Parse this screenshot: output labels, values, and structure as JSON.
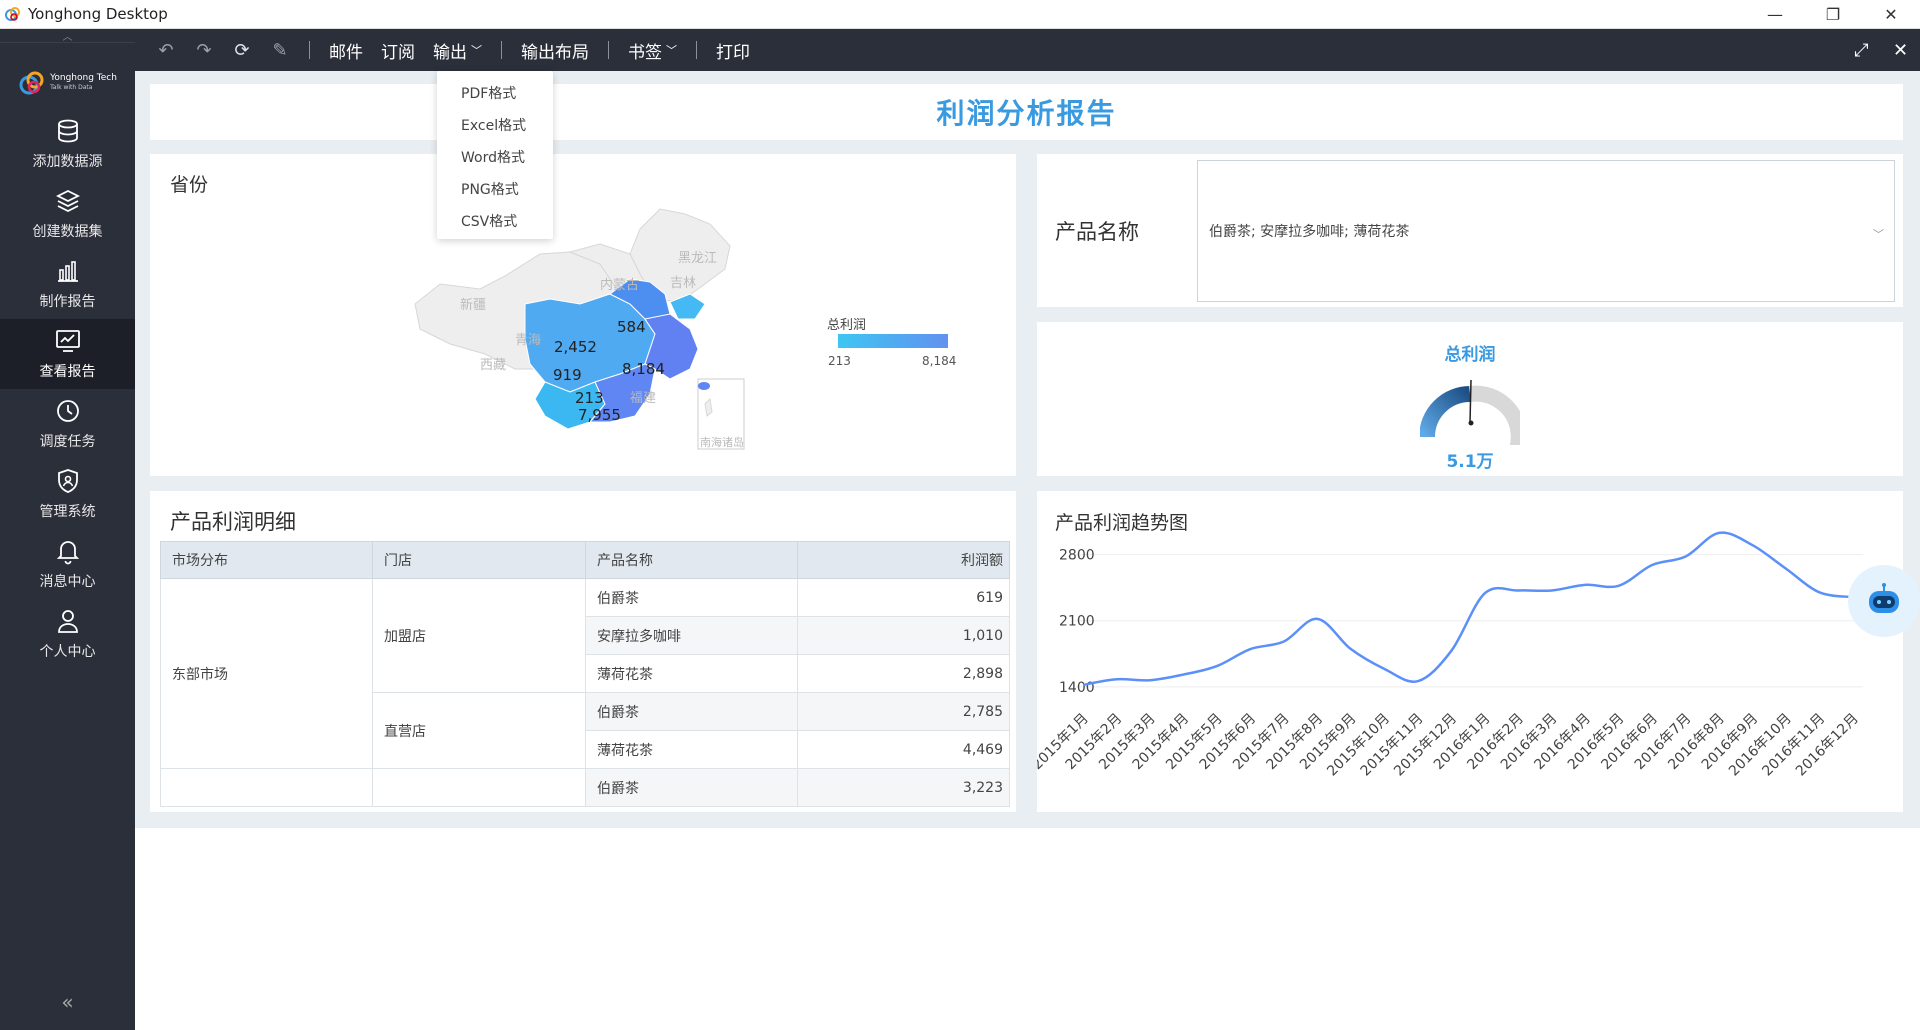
{
  "window": {
    "title": "Yonghong Desktop",
    "controls": [
      "—",
      "❐",
      "✕"
    ]
  },
  "sidebar": {
    "brand_name": "Yonghong Tech",
    "brand_tagline": "Talk with Data",
    "items": [
      {
        "label": "添加数据源",
        "icon": "database-icon"
      },
      {
        "label": "创建数据集",
        "icon": "layers-icon"
      },
      {
        "label": "制作报告",
        "icon": "bar-chart-icon"
      },
      {
        "label": "查看报告",
        "icon": "monitor-chart-icon",
        "active": true
      },
      {
        "label": "调度任务",
        "icon": "clock-icon"
      },
      {
        "label": "管理系统",
        "icon": "shield-user-icon"
      },
      {
        "label": "消息中心",
        "icon": "bell-icon"
      },
      {
        "label": "个人中心",
        "icon": "person-icon"
      }
    ],
    "collapse_label": "«"
  },
  "toolbar": {
    "mail": "邮件",
    "subscribe": "订阅",
    "export": "输出",
    "export_layout": "输出布局",
    "bookmark": "书签",
    "print": "打印"
  },
  "export_menu": [
    "PDF格式",
    "Excel格式",
    "Word格式",
    "PNG格式",
    "CSV格式"
  ],
  "report": {
    "title": "利润分析报告"
  },
  "map_panel": {
    "label": "省份",
    "legend_title": "总利润",
    "legend_min": "213",
    "legend_max": "8,184",
    "region_labels": [
      "黑龙江",
      "吉林",
      "内蒙古",
      "新疆",
      "青海",
      "西藏",
      "福建",
      "南海诸岛"
    ],
    "values": [
      "584",
      "2,452",
      "8,184",
      "919",
      "213",
      "7,955"
    ]
  },
  "filter_panel": {
    "label": "产品名称",
    "selected": "伯爵茶; 安摩拉多咖啡; 薄荷花茶"
  },
  "gauge_panel": {
    "title": "总利润",
    "value": "5.1万"
  },
  "table_panel": {
    "label": "产品利润明细",
    "headers": [
      "市场分布",
      "门店",
      "产品名称",
      "利润额"
    ],
    "market": "东部市场",
    "store_franchise": "加盟店",
    "store_direct": "直营店",
    "rows": [
      {
        "product": "伯爵茶",
        "profit": "619"
      },
      {
        "product": "安摩拉多咖啡",
        "profit": "1,010"
      },
      {
        "product": "薄荷花茶",
        "profit": "2,898"
      },
      {
        "product": "伯爵茶",
        "profit": "2,785"
      },
      {
        "product": "薄荷花茶",
        "profit": "4,469"
      },
      {
        "product": "伯爵茶",
        "profit": "3,223"
      }
    ]
  },
  "chart_data": {
    "type": "line",
    "title": "产品利润趋势图",
    "xlabel": "",
    "ylabel": "",
    "ylim": [
      1250,
      3050
    ],
    "yticks": [
      1400,
      2100,
      2800
    ],
    "categories": [
      "2015年1月",
      "2015年2月",
      "2015年3月",
      "2015年4月",
      "2015年5月",
      "2015年6月",
      "2015年7月",
      "2015年8月",
      "2015年9月",
      "2015年10月",
      "2015年11月",
      "2015年12月",
      "2016年1月",
      "2016年2月",
      "2016年3月",
      "2016年4月",
      "2016年5月",
      "2016年6月",
      "2016年7月",
      "2016年8月",
      "2016年9月",
      "2016年10月",
      "2016年11月",
      "2016年12月"
    ],
    "values": [
      1420,
      1480,
      1470,
      1530,
      1620,
      1800,
      1880,
      2120,
      1800,
      1590,
      1460,
      1780,
      2390,
      2420,
      2420,
      2480,
      2470,
      2690,
      2780,
      3030,
      2900,
      2650,
      2400,
      2350
    ],
    "color": "#5b8ff9",
    "grid": true
  }
}
